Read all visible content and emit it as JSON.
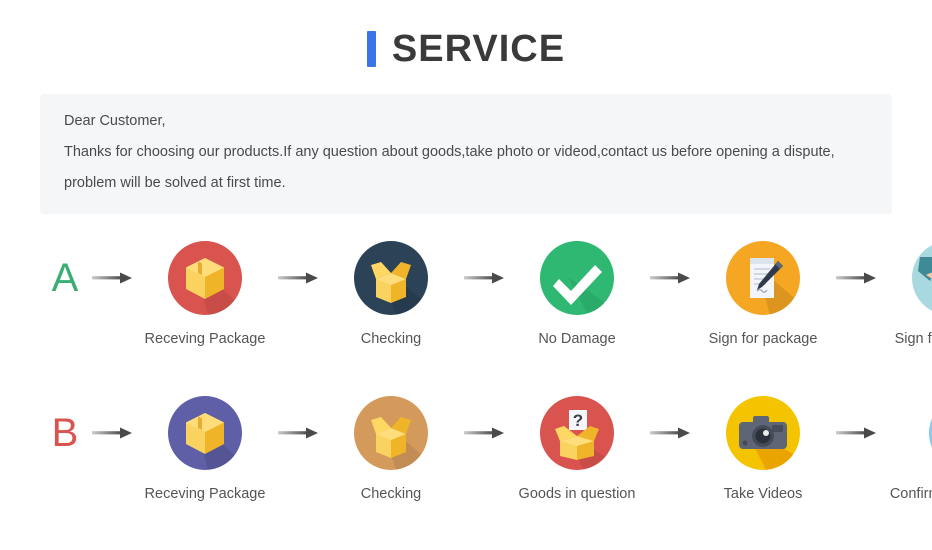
{
  "header": {
    "title": "SERVICE",
    "accent_color": "#3b73e8",
    "title_color": "#3a3a3a"
  },
  "notice": {
    "background": "#f5f6f8",
    "lines": [
      "Dear Customer,",
      "Thanks for choosing our products.If any question about goods,take photo or videod,contact us before opening a dispute,",
      "problem will be solved at first time."
    ]
  },
  "flows": [
    {
      "letter": "A",
      "letter_color": "#3aad74",
      "steps": [
        {
          "label": "Receving Package",
          "icon": "closed-box-icon",
          "circle_color": "#d9534f"
        },
        {
          "label": "Checking",
          "icon": "open-box-icon",
          "circle_color": "#2c4257"
        },
        {
          "label": "No Damage",
          "icon": "check-mark-icon",
          "circle_color": "#2eb872"
        },
        {
          "label": "Sign for package",
          "icon": "document-pen-icon",
          "circle_color": "#f5a623"
        },
        {
          "label": "Sign for package",
          "icon": "handshake-icon",
          "circle_color": "#a8d8e0"
        }
      ]
    },
    {
      "letter": "B",
      "letter_color": "#d9534f",
      "steps": [
        {
          "label": "Receving Package",
          "icon": "closed-box-icon",
          "circle_color": "#5f5fa8"
        },
        {
          "label": "Checking",
          "icon": "open-box-icon",
          "circle_color": "#d39a5c"
        },
        {
          "label": "Goods in question",
          "icon": "question-box-icon",
          "circle_color": "#d9534f"
        },
        {
          "label": "Take Videos",
          "icon": "camera-icon",
          "circle_color": "#f5c400"
        },
        {
          "label": "Confirm problem,refund money",
          "icon": "support-person-icon",
          "circle_color": "#87c9f2"
        }
      ]
    }
  ],
  "arrow": {
    "name": "arrow-right-icon",
    "color_start": "#c9c9c9",
    "color_end": "#4a4a4a"
  }
}
